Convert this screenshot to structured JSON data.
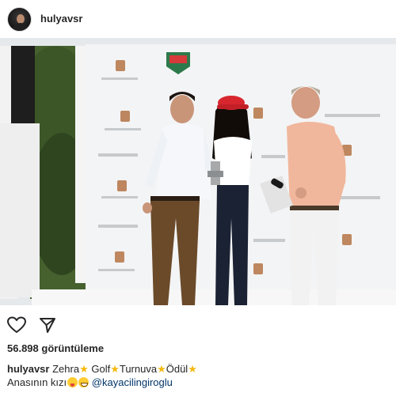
{
  "post": {
    "username": "hulyavsr",
    "views_text": "56.898 görüntüleme"
  },
  "caption": {
    "username": "hulyavsr",
    "words": [
      "Zehra",
      "Golf",
      "Turnuva",
      "Ödül"
    ],
    "second_line_text": "Anasının kızı",
    "mention": "@kayacilingiroglu"
  },
  "icons": {
    "like": "heart-icon",
    "share": "send-icon",
    "separator": "star-emoji"
  },
  "colors": {
    "star": "#f5b90f",
    "mention": "#003569",
    "cap_red": "#d8262e"
  }
}
